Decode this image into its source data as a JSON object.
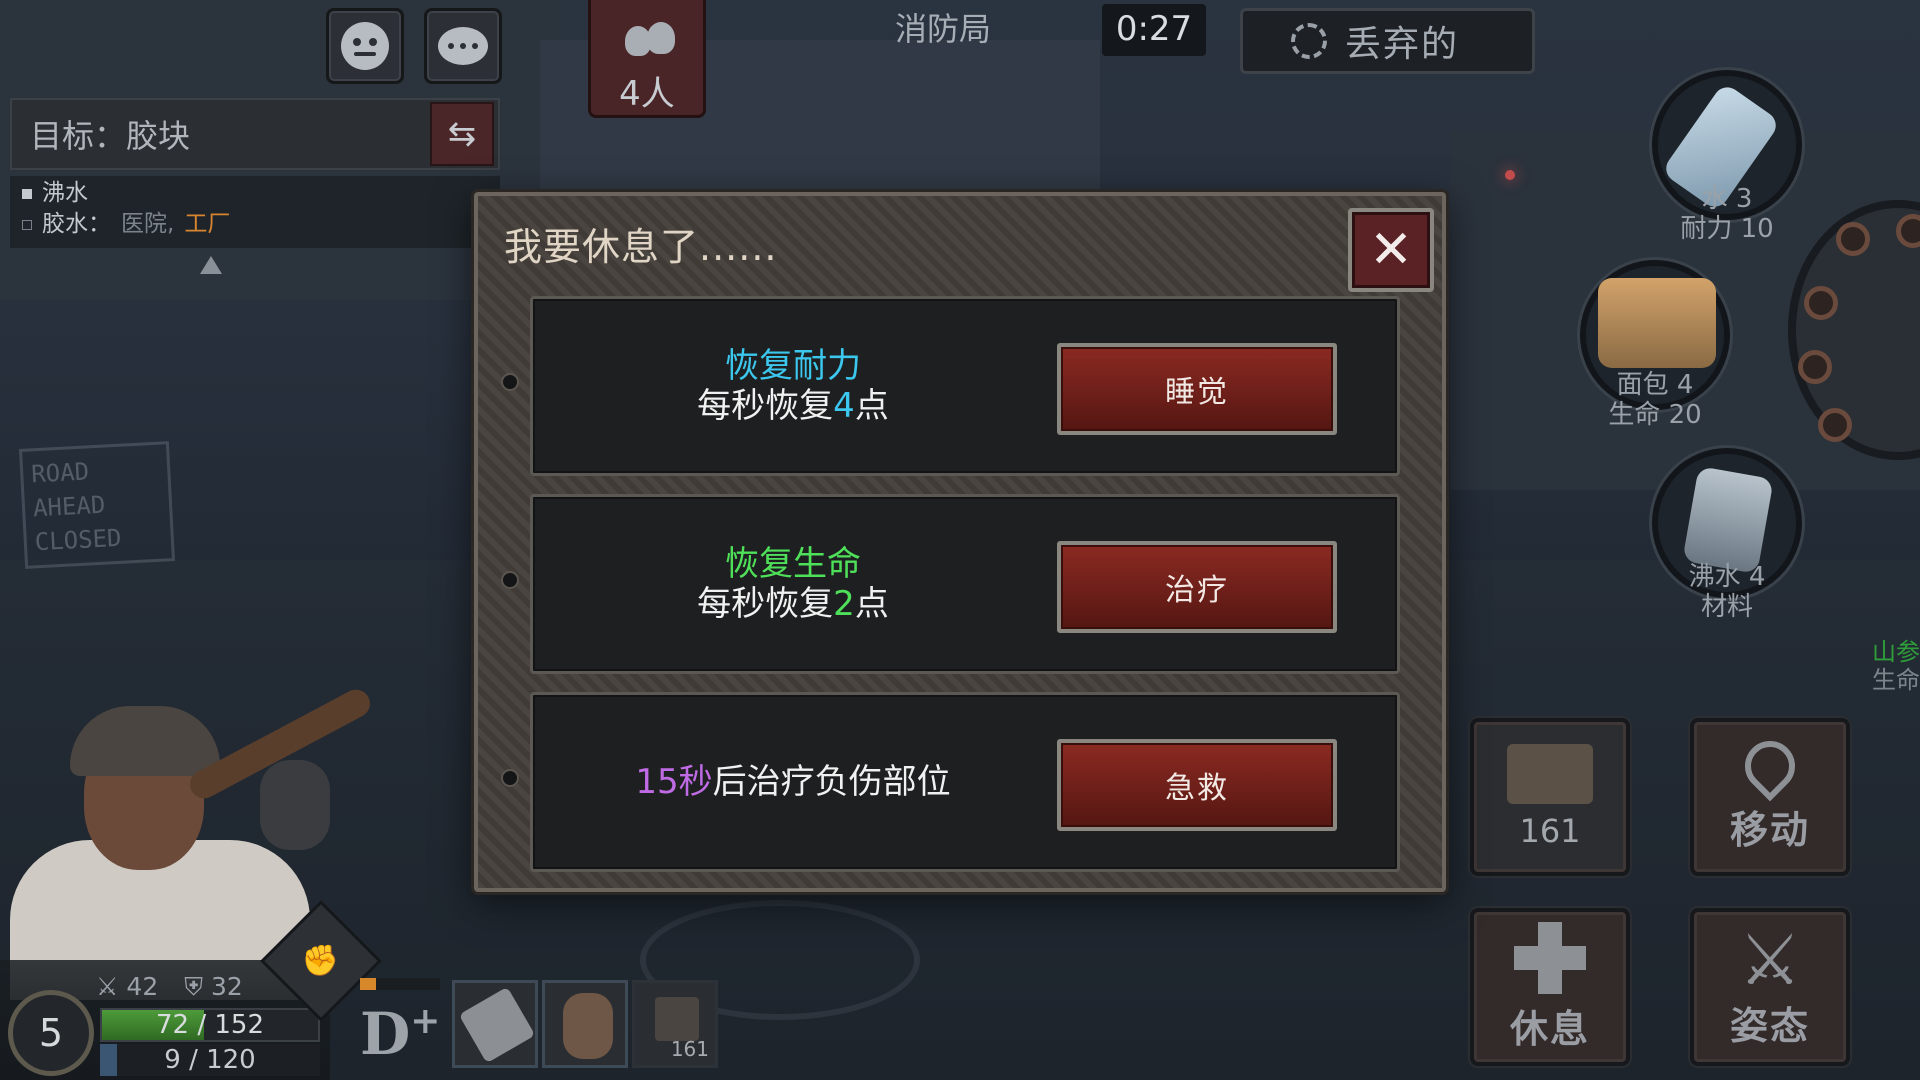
{
  "top_bar": {
    "players_count": "4人",
    "location": "消防局",
    "timer": "0:27",
    "discard_label": "丢弃的"
  },
  "objective": {
    "label": "目标：胶块",
    "items": [
      {
        "name": "沸水",
        "checked": true
      },
      {
        "name": "胶水：",
        "sources": "医院,",
        "highlight": "工厂",
        "checked": false
      }
    ]
  },
  "background": {
    "sign_lines": [
      "ROAD",
      "AHEAD",
      "CLOSED"
    ]
  },
  "inventory": [
    {
      "id": "water",
      "icon": "water-bottle-icon",
      "line1": "水 3",
      "line2": "耐力 10"
    },
    {
      "id": "bread",
      "icon": "bread-icon",
      "line1": "面包 4",
      "line2": "生命 20"
    },
    {
      "id": "boiled_water",
      "icon": "cup-icon",
      "line1": "沸水 4",
      "line2": "材料"
    },
    {
      "id": "ginseng",
      "icon": "ginseng-icon",
      "line1": "山参",
      "line2": "生命"
    }
  ],
  "actions": {
    "bag_count": "161",
    "move_label": "移动",
    "rest_label": "休息",
    "stance_label": "姿态"
  },
  "status": {
    "level": "5",
    "attack": "42",
    "defense": "32",
    "hp_text": "72 / 152",
    "hp_fraction": 0.47,
    "xp_text": "9 / 120",
    "xp_fraction": 0.075,
    "rank": "D",
    "rank_suffix": "+",
    "rank_progress": 0.2,
    "slot_count": "161"
  },
  "modal": {
    "title": "我要休息了......",
    "options": [
      {
        "title": "恢复耐力",
        "title_color": "#3cc7ee",
        "line_pre": "每秒恢复",
        "value": "4",
        "line_post": "点",
        "button": "睡觉"
      },
      {
        "title": "恢复生命",
        "title_color": "#4fe05a",
        "line_pre": "每秒恢复",
        "value": "2",
        "line_post": "点",
        "button": "治疗"
      },
      {
        "timed_pre": "15秒",
        "timed_post": "后治疗负伤部位",
        "timed_color": "#c06be6",
        "button": "急救"
      }
    ]
  },
  "colors": {
    "button_red": "#7a2620",
    "cyan": "#3cc7ee",
    "green": "#4fe05a",
    "purple": "#c06be6"
  }
}
